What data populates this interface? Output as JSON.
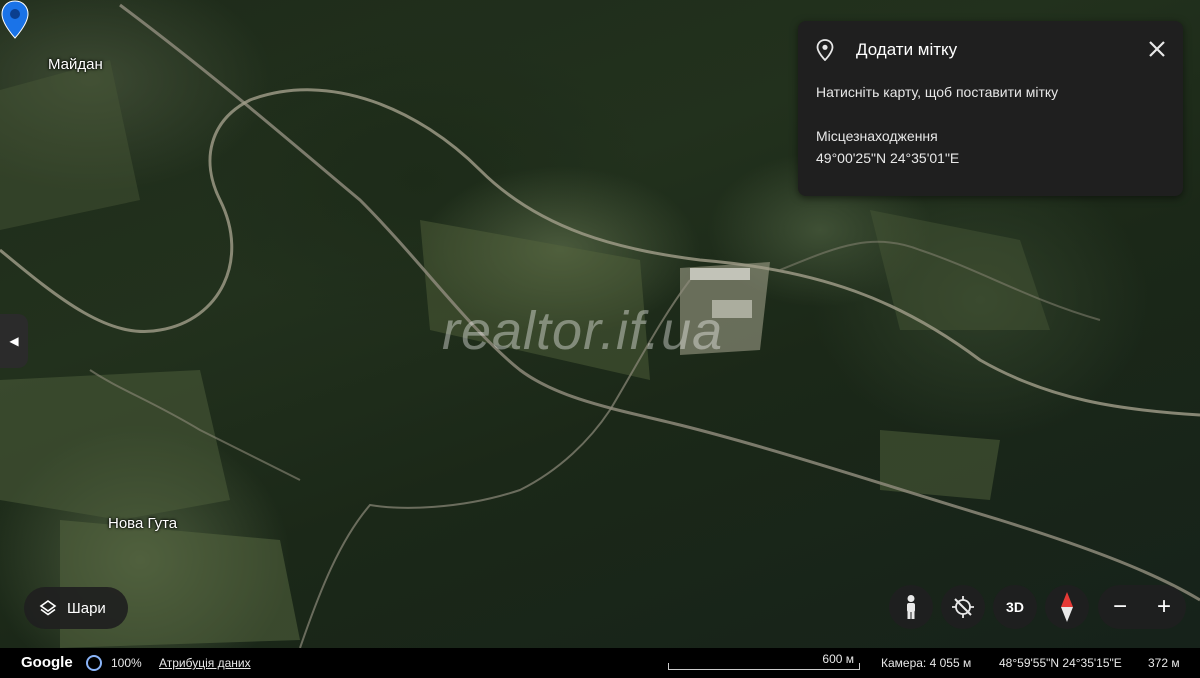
{
  "map": {
    "place_labels": [
      "Майдан",
      "Нова Гута"
    ],
    "watermark": "realtor.if.ua"
  },
  "panel": {
    "icon": "location-pin-icon",
    "title": "Додати мітку",
    "hint": "Натисніть карту, щоб поставити мітку",
    "location_label": "Місцезнаходження",
    "location_value": "49°00'25\"N 24°35'01\"E"
  },
  "controls": {
    "layers_label": "Шари",
    "three_d_label": "3D",
    "zoom_out": "−",
    "zoom_in": "+"
  },
  "footer": {
    "brand": "Google",
    "percent": "100%",
    "attribution": "Атрибуція даних",
    "scale_label": "600 м",
    "camera": "Камера: 4 055 м",
    "coords": "48°59'55\"N 24°35'15\"E",
    "elevation": "372 м"
  },
  "colors": {
    "pin": "#1a73e8",
    "panel_bg": "#1f1f1f",
    "accent_ring": "#8ab4f8"
  }
}
